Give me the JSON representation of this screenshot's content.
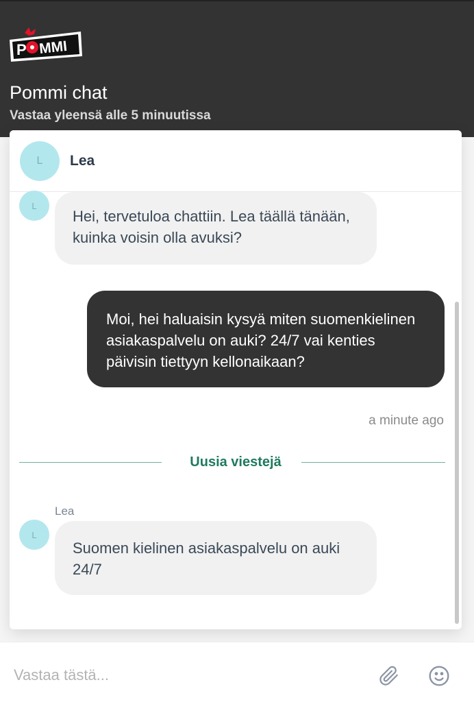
{
  "header": {
    "logo_text": "POMMI",
    "title": "Pommi chat",
    "subtitle": "Vastaa yleensä alle 5 minuutissa"
  },
  "agent": {
    "initial": "L",
    "name": "Lea"
  },
  "messages": [
    {
      "from": "agent",
      "text": "Hei, tervetuloa chattiin. Lea täällä tänään, kuinka voisin olla avuksi?"
    },
    {
      "from": "user",
      "text": "Moi, hei haluaisin kysyä miten suomenkielinen asiakaspalvelu on auki? 24/7 vai kenties päivisin tiettyyn kellonaikaan?",
      "time": "a minute ago"
    },
    {
      "from": "agent",
      "sender": "Lea",
      "text": "Suomen kielinen asiakaspalvelu on auki 24/7"
    }
  ],
  "divider": {
    "label": "Uusia viestejä"
  },
  "composer": {
    "placeholder": "Vastaa tästä...",
    "attach_icon": "paperclip-icon",
    "emoji_icon": "smiley-icon"
  },
  "colors": {
    "header_bg": "#333333",
    "user_bubble": "#333333",
    "agent_bubble": "#f1f1f1",
    "avatar_bg": "#b3e7ee",
    "divider_accent": "#1f7a5f",
    "logo_red": "#e2122a"
  }
}
